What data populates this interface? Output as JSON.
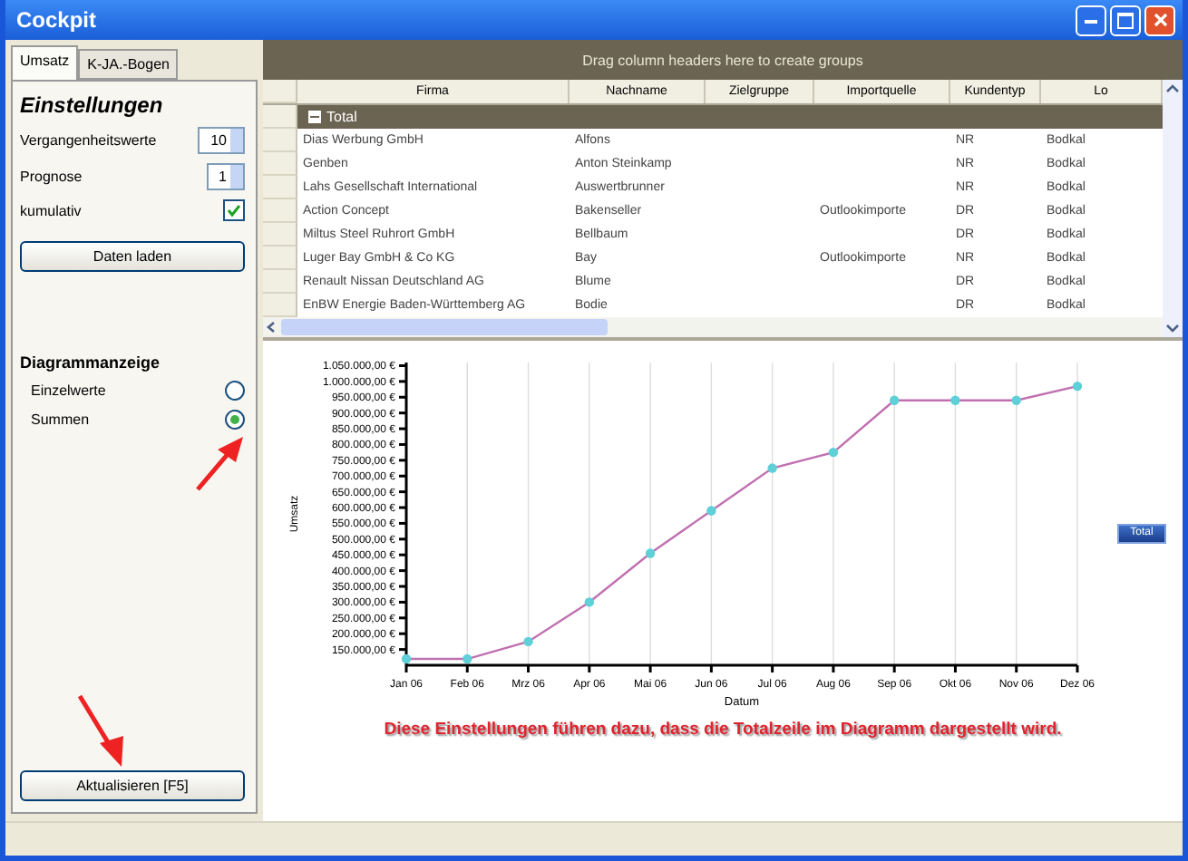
{
  "window": {
    "title": "Cockpit"
  },
  "tabs": [
    {
      "label": "Umsatz",
      "selected": true
    },
    {
      "label": "K-JA.-Bogen",
      "selected": false
    }
  ],
  "settings": {
    "heading": "Einstellungen",
    "fields": [
      {
        "kind": "spinner",
        "label": "Vergangenheitswerte",
        "value": "10"
      },
      {
        "kind": "spinner",
        "label": "Prognose",
        "value": "1"
      },
      {
        "kind": "checkbox",
        "label": "kumulativ",
        "checked": true
      }
    ],
    "load_button": "Daten laden"
  },
  "display": {
    "heading": "Diagrammanzeige",
    "options": [
      {
        "label": "Einzelwerte",
        "selected": false
      },
      {
        "label": "Summen",
        "selected": true
      }
    ]
  },
  "refresh_button": "Aktualisieren [F5]",
  "grid": {
    "group_panel": "Drag column headers here to create groups",
    "columns": [
      "Firma",
      "Nachname",
      "Zielgruppe",
      "Importquelle",
      "Kundentyp",
      "Lo"
    ],
    "group_row": {
      "label": "Total",
      "expanded": true
    },
    "rows": [
      [
        "Dias Werbung GmbH",
        "Alfons",
        "",
        "",
        "NR",
        "Bodkal"
      ],
      [
        "Genben",
        "Anton Steinkamp",
        "",
        "",
        "NR",
        "Bodkal"
      ],
      [
        "Lahs Gesellschaft International",
        "Auswertbrunner",
        "",
        "",
        "NR",
        "Bodkal"
      ],
      [
        "Action Concept",
        "Bakenseller",
        "",
        "Outlookimporte",
        "DR",
        "Bodkal"
      ],
      [
        "Miltus Steel Ruhrort GmbH",
        "Bellbaum",
        "",
        "",
        "DR",
        "Bodkal"
      ],
      [
        "Luger Bay GmbH & Co KG",
        "Bay",
        "",
        "Outlookimporte",
        "NR",
        "Bodkal"
      ],
      [
        "Renault Nissan Deutschland AG",
        "Blume",
        "",
        "",
        "DR",
        "Bodkal"
      ],
      [
        "EnBW Energie Baden-Württemberg AG",
        "Bodie",
        "",
        "",
        "DR",
        "Bodkal"
      ]
    ]
  },
  "chart": {
    "caption": "Diese Einstellungen führen dazu, dass die Totalzeile im Diagramm dargestellt wird.",
    "chart_data": {
      "type": "line",
      "grid": true,
      "xlabel": "Datum",
      "ylabel": "Umsatz",
      "categories": [
        "Jan 06",
        "Feb 06",
        "Mrz 06",
        "Apr 06",
        "Mai 06",
        "Jun 06",
        "Jul 06",
        "Aug 06",
        "Sep 06",
        "Okt 06",
        "Nov 06",
        "Dez 06"
      ],
      "series": [
        {
          "name": "Total",
          "color": "#c070b0",
          "marker": true,
          "values": [
            120000,
            120000,
            175000,
            300000,
            455000,
            590000,
            725000,
            775000,
            940000,
            940000,
            940000,
            985000
          ]
        }
      ],
      "ylim": [
        100000,
        1060000
      ],
      "yticks": [
        {
          "value": 150000,
          "label": "150.000,00 €"
        },
        {
          "value": 200000,
          "label": "200.000,00 €"
        },
        {
          "value": 250000,
          "label": "250.000,00 €"
        },
        {
          "value": 300000,
          "label": "300.000,00 €"
        },
        {
          "value": 350000,
          "label": "350.000,00 €"
        },
        {
          "value": 400000,
          "label": "400.000,00 €"
        },
        {
          "value": 450000,
          "label": "450.000,00 €"
        },
        {
          "value": 500000,
          "label": "500.000,00 €"
        },
        {
          "value": 550000,
          "label": "550.000,00 €"
        },
        {
          "value": 600000,
          "label": "600.000,00 €"
        },
        {
          "value": 650000,
          "label": "650.000,00 €"
        },
        {
          "value": 700000,
          "label": "700.000,00 €"
        },
        {
          "value": 750000,
          "label": "750.000,00 €"
        },
        {
          "value": 800000,
          "label": "800.000,00 €"
        },
        {
          "value": 850000,
          "label": "850.000,00 €"
        },
        {
          "value": 900000,
          "label": "900.000,00 €"
        },
        {
          "value": 950000,
          "label": "950.000,00 €"
        },
        {
          "value": 1000000,
          "label": "1.000.000,00 €"
        },
        {
          "value": 1050000,
          "label": "1.050.000,00 €"
        }
      ]
    }
  }
}
